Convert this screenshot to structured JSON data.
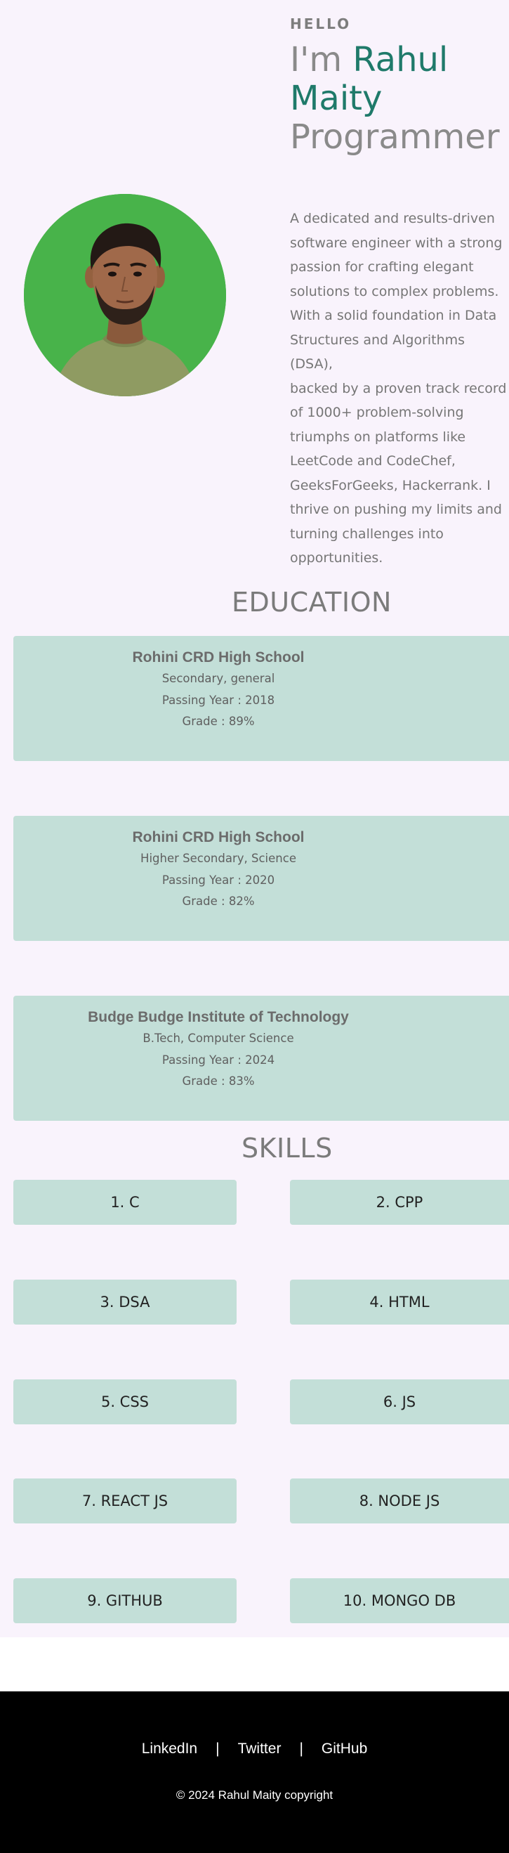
{
  "hero": {
    "greeting": "HELLO",
    "title_prefix": "I'm ",
    "name_first": "Rahul",
    "name_last": "Maity",
    "role": "Programmer",
    "bio": "A dedicated and results-driven\nsoftware engineer with a strong\npassion for crafting elegant\nsolutions to complex problems.\nWith a solid foundation in Data\nStructures and Algorithms (DSA),\nbacked by a proven track record\nof 1000+ problem-solving\ntriumphs on platforms like\nLeetCode and CodeChef,\nGeeksForGeeks, Hackerrank. I\nthrive on pushing my limits and\nturning challenges into\nopportunities."
  },
  "education": {
    "title": "EDUCATION",
    "items": [
      {
        "school": "Rohini CRD High School",
        "course": "Secondary, general",
        "year": "Passing Year : 2018",
        "grade": "Grade : 89%"
      },
      {
        "school": "Rohini CRD High School",
        "course": "Higher Secondary, Science",
        "year": "Passing Year : 2020",
        "grade": "Grade : 82%"
      },
      {
        "school": "Budge Budge Institute of Technology",
        "course": "B.Tech, Computer Science",
        "year": "Passing Year : 2024",
        "grade": "Grade : 83%"
      }
    ]
  },
  "skills": {
    "title": "SKILLS",
    "items": [
      "1. C",
      "2. CPP",
      "3. DSA",
      "4. HTML",
      "5. CSS",
      "6. JS",
      "7. REACT JS",
      "8. NODE JS",
      "9. GITHUB",
      "10. MONGO DB"
    ]
  },
  "footer": {
    "links": [
      "LinkedIn",
      "Twitter",
      "GitHub"
    ],
    "separator": "|",
    "copyright": "© 2024 Rahul Maity copyright"
  },
  "colors": {
    "page_bg": "#f9f3fc",
    "accent": "#1f7a6a",
    "card_bg": "#c3dfd8",
    "footer_bg": "#000000"
  },
  "icons": {
    "avatar": "profile-photo"
  }
}
